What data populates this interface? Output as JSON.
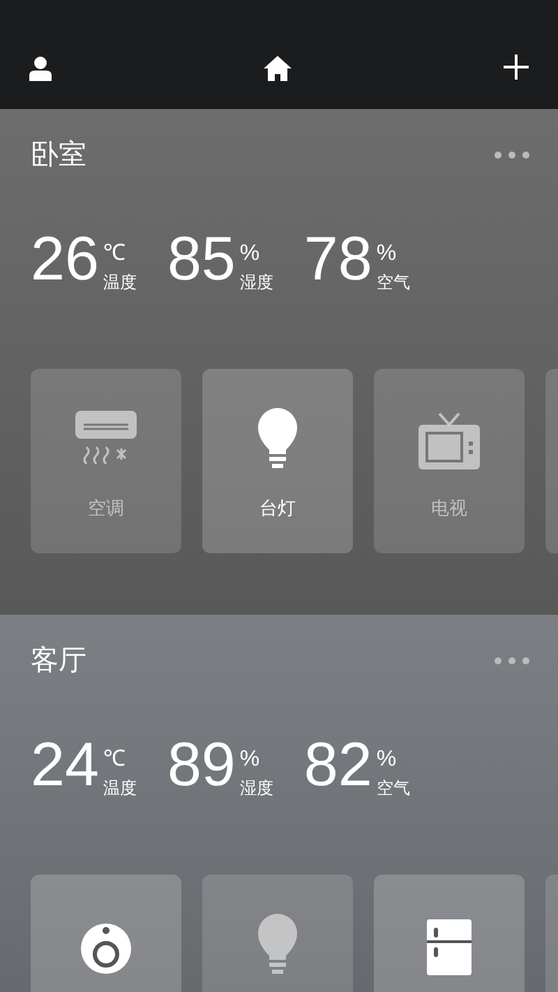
{
  "rooms": [
    {
      "name": "卧室",
      "stats": [
        {
          "value": "26",
          "unit": "℃",
          "label": "温度"
        },
        {
          "value": "85",
          "unit": "%",
          "label": "湿度"
        },
        {
          "value": "78",
          "unit": "%",
          "label": "空气"
        }
      ],
      "devices": [
        {
          "kind": "ac",
          "name": "空调",
          "on": false
        },
        {
          "kind": "lamp",
          "name": "台灯",
          "on": true
        },
        {
          "kind": "tv",
          "name": "电视",
          "on": false
        },
        {
          "kind": "other"
        }
      ]
    },
    {
      "name": "客厅",
      "stats": [
        {
          "value": "24",
          "unit": "℃",
          "label": "温度"
        },
        {
          "value": "89",
          "unit": "%",
          "label": "湿度"
        },
        {
          "value": "82",
          "unit": "%",
          "label": "空气"
        }
      ],
      "devices": [
        {
          "kind": "camera",
          "on": true
        },
        {
          "kind": "lamp",
          "on": false
        },
        {
          "kind": "fridge",
          "on": true
        },
        {
          "kind": "other"
        }
      ]
    }
  ]
}
